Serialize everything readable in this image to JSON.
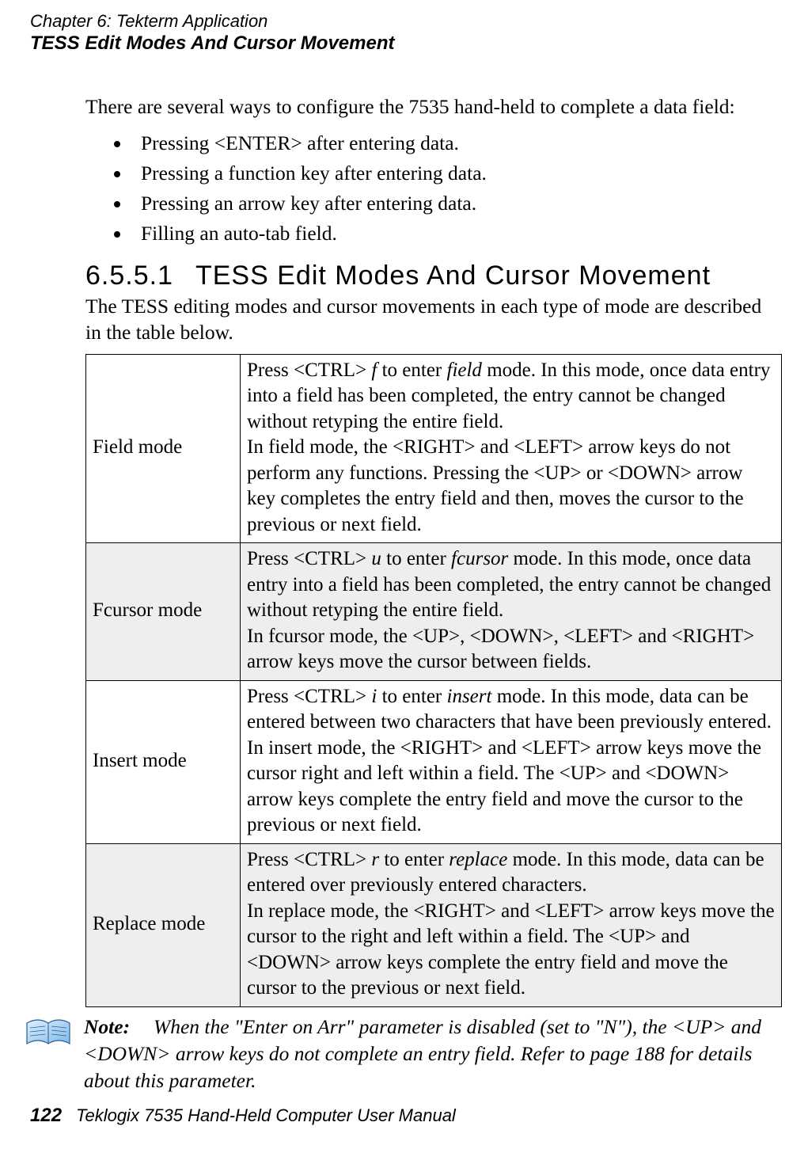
{
  "running_head": {
    "line1": "Chapter 6: Tekterm Application",
    "line2": "TESS Edit Modes And Cursor Movement"
  },
  "intro": "There are several ways to configure the 7535 hand-held to complete a data field:",
  "bullets": [
    "Pressing <ENTER> after entering data.",
    "Pressing a function key after entering data.",
    "Pressing an arrow key after entering data.",
    "Filling an auto-tab field."
  ],
  "heading": {
    "number": "6.5.5.1",
    "title": "TESS Edit Modes And Cursor Movement"
  },
  "after_heading": "The TESS editing modes and cursor movements in each type of mode are described in the table below.",
  "table": {
    "rows": [
      {
        "label": "Field mode",
        "p1_pre": "Press  <CTRL> ",
        "p1_key": "f",
        "p1_mid": "  to enter ",
        "p1_mode": "field",
        "p1_post": " mode. In this mode, once data entry into a field has been completed, the entry cannot be changed without retyping the entire field.",
        "p2": "In field mode, the <RIGHT> and <LEFT> arrow keys do not perform any functions. Pressing the <UP> or <DOWN> arrow key completes the entry field and then, moves the cursor to the previous or next field."
      },
      {
        "label": "Fcursor mode",
        "p1_pre": "Press  <CTRL> ",
        "p1_key": "u",
        "p1_mid": "  to enter ",
        "p1_mode": "fcursor",
        "p1_post": " mode. In this mode, once data entry into a field has been completed, the entry cannot be changed without retyping the entire field.",
        "p2": "In fcursor mode, the <UP>, <DOWN>, <LEFT> and <RIGHT> arrow keys move the cursor between fields."
      },
      {
        "label": "Insert mode",
        "p1_pre": "Press  <CTRL> ",
        "p1_key": "i",
        "p1_mid": "  to enter ",
        "p1_mode": "insert",
        "p1_post": " mode. In this mode, data can be entered between two characters that have been previously entered.",
        "p2": "In insert mode, the <RIGHT> and <LEFT> arrow keys move the cursor right and left within a field. The <UP> and <DOWN> arrow keys complete the entry field and move the cursor to the previous or next field."
      },
      {
        "label": "Replace mode",
        "p1_pre": "Press  <CTRL> ",
        "p1_key": "r",
        "p1_mid": "  to enter ",
        "p1_mode": "replace",
        "p1_post": " mode. In this mode, data can be entered over previously entered characters.",
        "p2": "In replace mode, the <RIGHT> and <LEFT> arrow keys move the cursor to the right and left within a field. The <UP> and <DOWN> arrow keys complete the entry field and move the cursor to the previous or next field."
      }
    ]
  },
  "note": {
    "label": "Note:",
    "text": "When the \"Enter on Arr\" parameter is disabled (set to \"N\"), the <UP> and <DOWN> arrow keys do not complete an entry field. Refer to page 188 for details about this parameter."
  },
  "footer": {
    "page": "122",
    "title": "Teklogix 7535 Hand-Held Computer User Manual"
  }
}
